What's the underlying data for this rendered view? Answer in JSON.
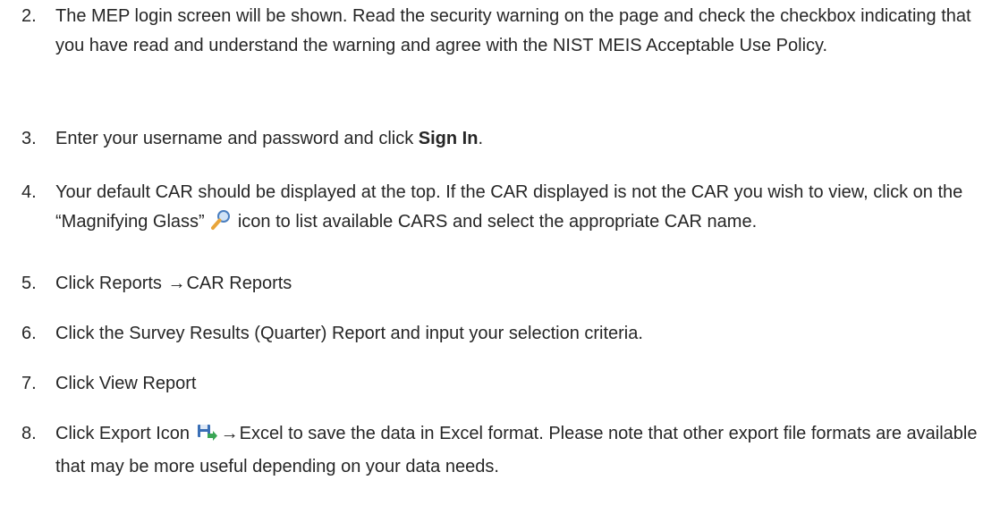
{
  "steps": [
    {
      "num": "2.",
      "text": "The MEP login screen will be shown. Read the security warning on the page and check the checkbox indicating that you have read and understand the warning and agree with the NIST MEIS Acceptable Use Policy."
    },
    {
      "num": "3.",
      "pre": "Enter your username and password and click ",
      "bold": "Sign In",
      "post": "."
    },
    {
      "num": "4.",
      "pre": "Your default CAR should be displayed at the top. If the CAR displayed is not the CAR you wish to view, click on the “Magnifying Glass” ",
      "icon": "magnifying-glass-icon",
      "post": " icon to list available CARS and select the appropriate CAR name."
    },
    {
      "num": "5.",
      "pre": "Click Reports ",
      "arrow": "→",
      "post": "CAR Reports"
    },
    {
      "num": "6.",
      "text": "Click the Survey Results (Quarter) Report and input your selection criteria."
    },
    {
      "num": "7.",
      "text": "Click View Report"
    },
    {
      "num": "8.",
      "pre": "Click Export Icon ",
      "icon": "export-icon",
      "arrow": "→",
      "post": "Excel to save the data in Excel format. Please note that other export file formats are available that may be more useful depending on your data needs."
    }
  ],
  "colors": {
    "text": "#262626",
    "icon_blue": "#3a6fb6",
    "icon_green": "#3aa655",
    "magnifier_orange": "#e8a53a",
    "magnifier_glass": "#cfe3f7"
  }
}
